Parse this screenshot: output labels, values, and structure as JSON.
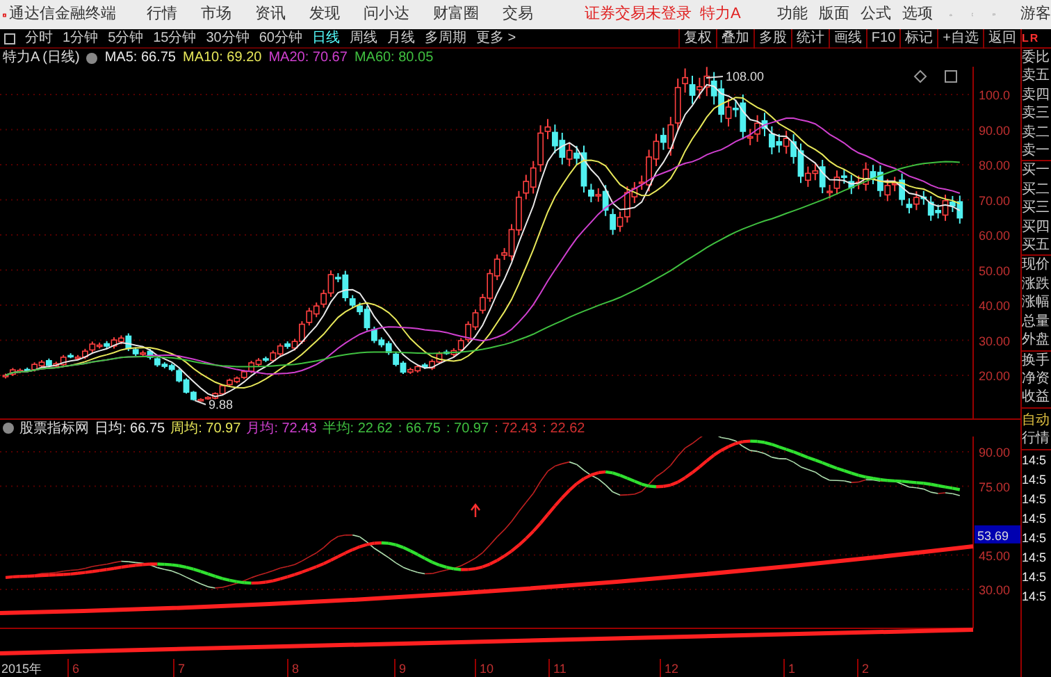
{
  "app": {
    "title": "通达信金融终端",
    "menu": [
      "行情",
      "市场",
      "资讯",
      "发现",
      "问小达",
      "财富圈",
      "交易"
    ],
    "notice": "证券交易未登录",
    "stock": "特力A",
    "tools": [
      "功能",
      "版面",
      "公式",
      "选项"
    ],
    "user": "游客"
  },
  "toolbar": {
    "periods": [
      {
        "label": "分时",
        "selected": false
      },
      {
        "label": "1分钟",
        "selected": false
      },
      {
        "label": "5分钟",
        "selected": false
      },
      {
        "label": "15分钟",
        "selected": false
      },
      {
        "label": "30分钟",
        "selected": false
      },
      {
        "label": "60分钟",
        "selected": false
      },
      {
        "label": "日线",
        "selected": true
      },
      {
        "label": "周线",
        "selected": false
      },
      {
        "label": "月线",
        "selected": false
      },
      {
        "label": "多周期",
        "selected": false
      },
      {
        "label": "更多 >",
        "selected": false
      }
    ],
    "actions": [
      "复权",
      "叠加",
      "多股",
      "统计",
      "画线",
      "F10",
      "标记",
      "+自选",
      "返回"
    ]
  },
  "price_chart": {
    "stock": "特力A",
    "period": "(日线)",
    "ma": [
      {
        "label": "MA5: 66.75",
        "color": "#e8e8e8"
      },
      {
        "label": "MA10: 69.20",
        "color": "#e8e85a"
      },
      {
        "label": "MA20: 70.67",
        "color": "#d040d0"
      },
      {
        "label": "MA60: 80.05",
        "color": "#40c040"
      }
    ],
    "axis": [
      "100.0",
      "90.00",
      "80.00",
      "70.00",
      "60.00",
      "50.00",
      "40.00",
      "30.00",
      "20.00"
    ],
    "high": "108.00",
    "low": "9.88"
  },
  "indicator": {
    "name": "股票指标网",
    "items": [
      {
        "label": "日均: 66.75",
        "color": "#e8e8e8"
      },
      {
        "label": "周均: 70.97",
        "color": "#e8e85a"
      },
      {
        "label": "月均: 72.43",
        "color": "#d040d0"
      },
      {
        "label": "半均: 22.62",
        "color": "#40c040"
      },
      {
        "label": ": 66.75",
        "color": "#40c040"
      },
      {
        "label": ": 70.97",
        "color": "#40c040"
      },
      {
        "label": ": 72.43",
        "color": "#d03030"
      },
      {
        "label": ": 22.62",
        "color": "#d03030"
      }
    ],
    "axis": [
      "90.00",
      "75.00",
      "45.00",
      "30.00"
    ],
    "current": "53.69"
  },
  "quote_panel": {
    "header": [
      "L",
      "R"
    ],
    "labels": [
      "委比",
      "卖五",
      "卖四",
      "卖三",
      "卖二",
      "卖一",
      "买一",
      "买二",
      "买三",
      "买四",
      "买五",
      "现价",
      "涨跌",
      "涨幅",
      "总量",
      "外盘",
      "换手",
      "净资",
      "收益"
    ],
    "auto": "自动",
    "market": "行情",
    "times": [
      "14:5",
      "14:5",
      "14:5",
      "14:5",
      "14:5",
      "14:5",
      "14:5",
      "14:5"
    ]
  },
  "date_axis": [
    "2015年",
    "6",
    "7",
    "8",
    "9",
    "10",
    "11",
    "12",
    "1",
    "2"
  ]
}
